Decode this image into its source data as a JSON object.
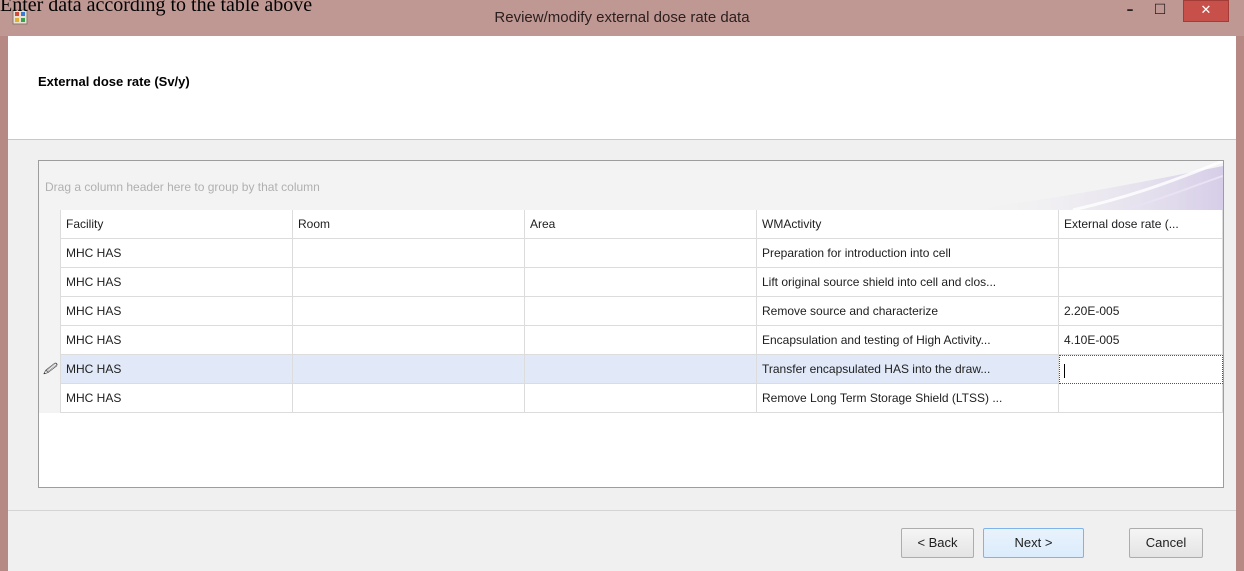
{
  "document_caption": "Enter data according to the table above",
  "window": {
    "title": "Review/modify external dose rate data",
    "minimize_glyph": "–",
    "maximize_glyph": "☐",
    "close_glyph": "✕"
  },
  "header": {
    "label": "External dose rate (Sv/y)"
  },
  "grid": {
    "group_hint": "Drag a column header here to group by that column",
    "columns": [
      "Facility",
      "Room",
      "Area",
      "WMActivity",
      "External dose rate (..."
    ],
    "rows": [
      {
        "indicator": "",
        "facility": "MHC HAS",
        "room": "",
        "area": "",
        "activity": "Preparation for  introduction into cell",
        "dose": ""
      },
      {
        "indicator": "",
        "facility": "MHC HAS",
        "room": "",
        "area": "",
        "activity": "Lift original source shield into cell and clos...",
        "dose": ""
      },
      {
        "indicator": "",
        "facility": "MHC HAS",
        "room": "",
        "area": "",
        "activity": "Remove source and characterize",
        "dose": "2.20E-005"
      },
      {
        "indicator": "",
        "facility": "MHC HAS",
        "room": "",
        "area": "",
        "activity": "Encapsulation and testing of High Activity...",
        "dose": "4.10E-005"
      },
      {
        "indicator": "🖉",
        "facility": "MHC HAS",
        "room": "",
        "area": "",
        "activity": "Transfer encapsulated HAS into the draw...",
        "dose": ""
      },
      {
        "indicator": "",
        "facility": "MHC HAS",
        "room": "",
        "area": "",
        "activity": "Remove Long Term Storage Shield (LTSS) ...",
        "dose": ""
      }
    ]
  },
  "footer": {
    "back_label": "< Back",
    "next_label": "Next >",
    "cancel_label": "Cancel"
  }
}
